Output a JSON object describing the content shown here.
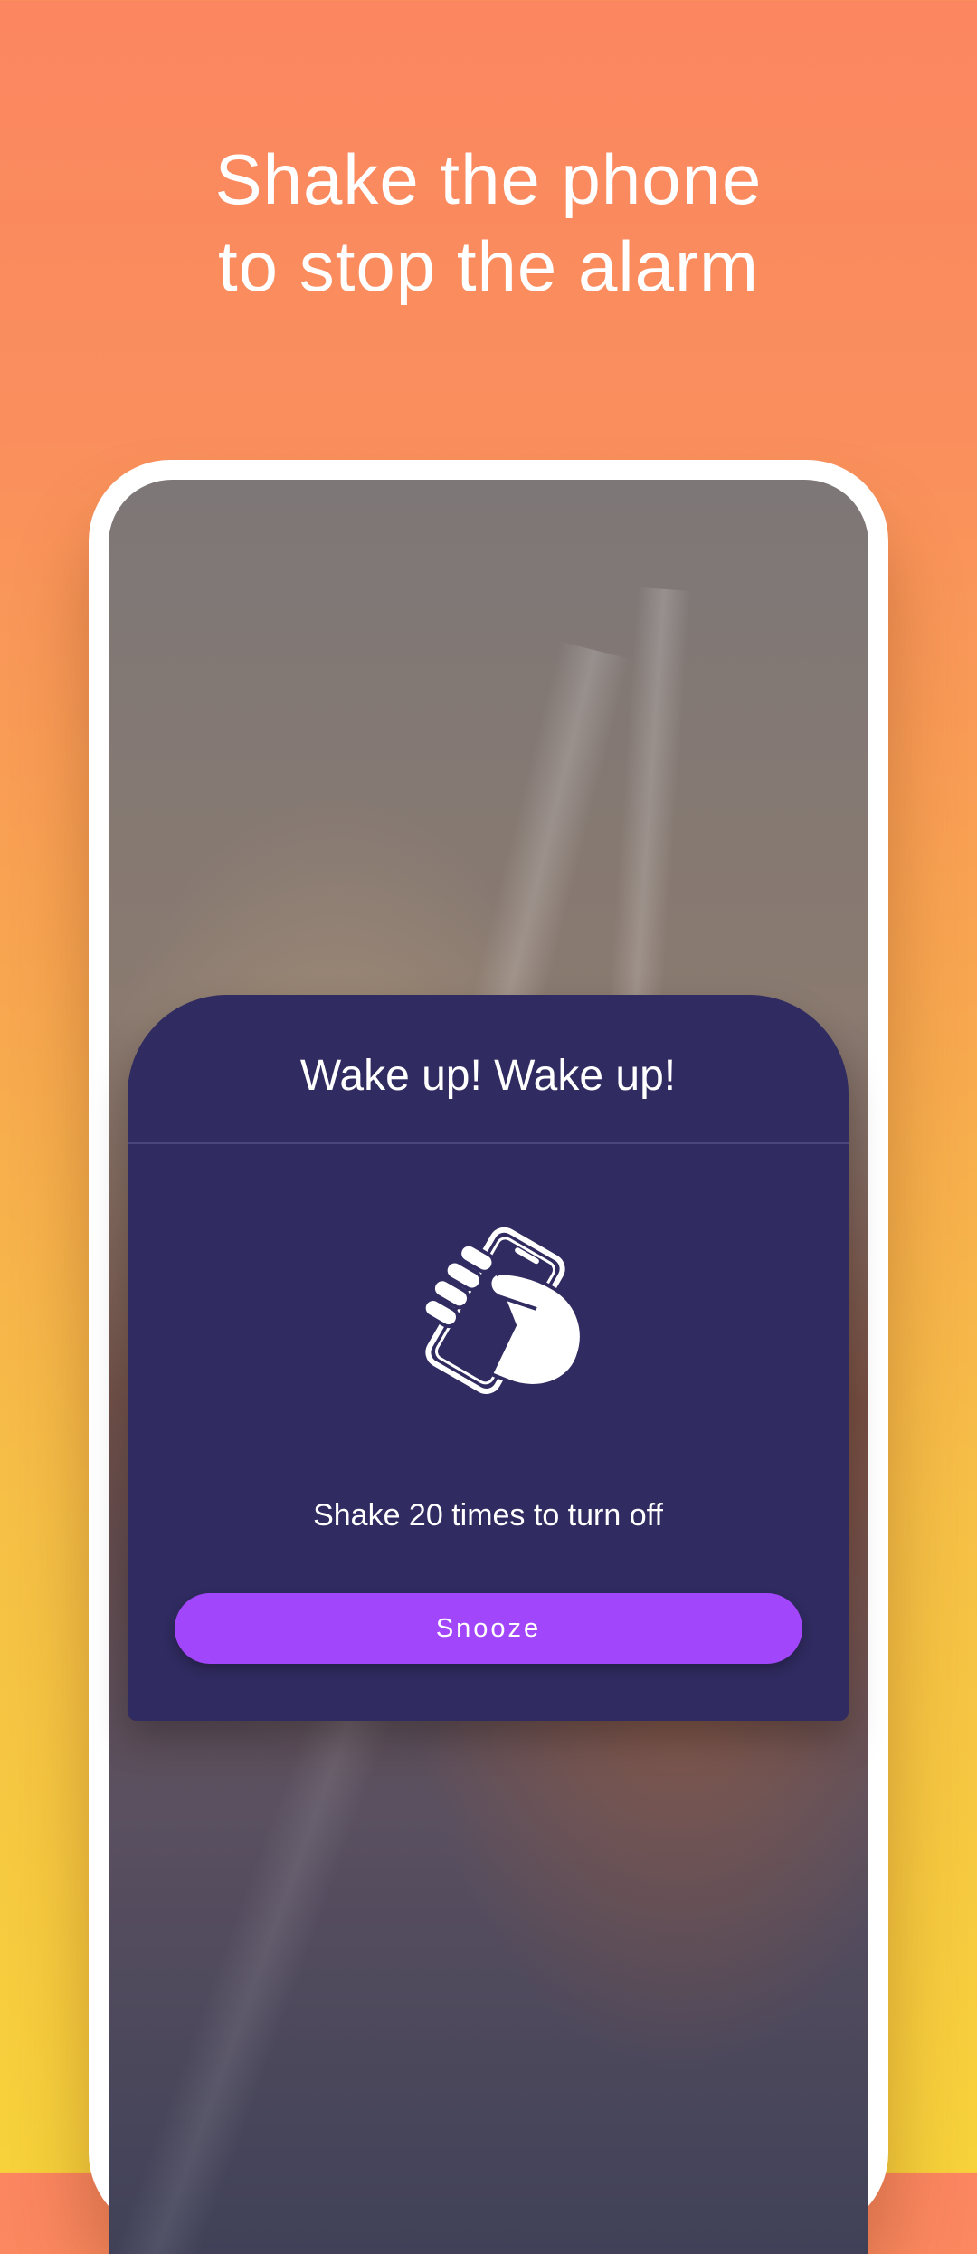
{
  "promo": {
    "headline_line1": "Shake the phone",
    "headline_line2": "to stop the alarm"
  },
  "alarm_dialog": {
    "title": "Wake up! Wake up!",
    "icon": "shake-phone-icon",
    "instruction": "Shake 20 times to turn off",
    "snooze_label": "Snooze"
  },
  "colors": {
    "background_top": "#fb8660",
    "background_bottom": "#f7d23b",
    "dialog_bg": "#302b60",
    "accent": "#a246fb",
    "text": "#ffffff"
  }
}
